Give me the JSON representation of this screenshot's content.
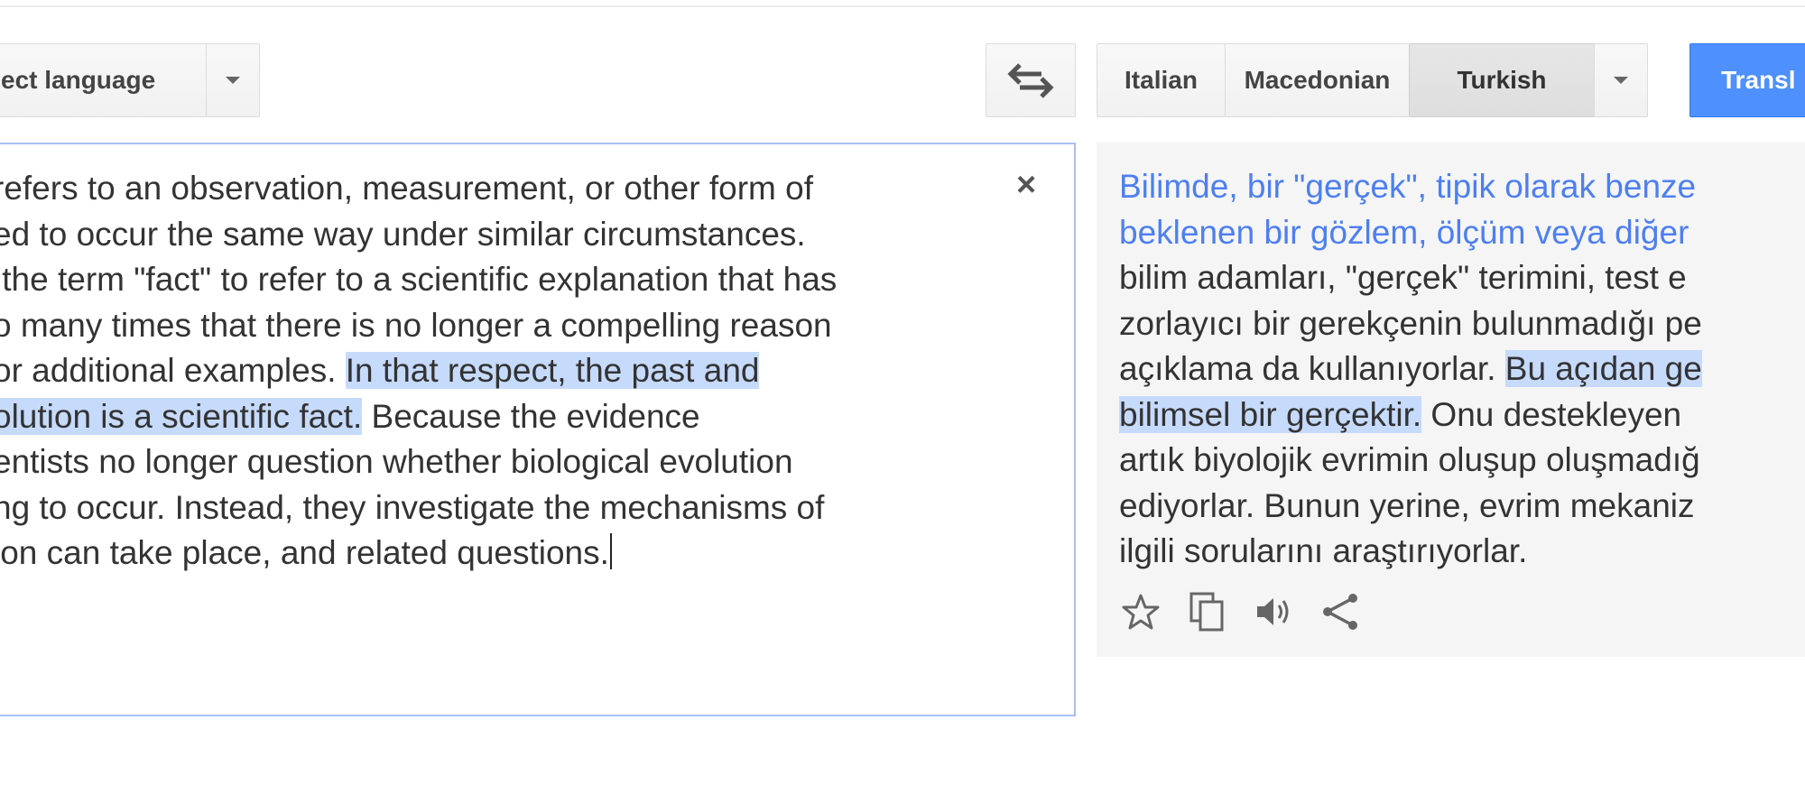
{
  "controls": {
    "detect_language": "ect language",
    "languages": [
      "Italian",
      "Macedonian",
      "Turkish"
    ],
    "selected_language": "Turkish",
    "translate_label": "Transl"
  },
  "source": {
    "lines": [
      "refers to an observation, measurement, or other form of",
      "ed to occur the same way under similar circumstances.",
      " the term \"fact\" to refer to a scientific explanation that has",
      "o many times that there is no longer a compelling reason",
      "or additional examples. ",
      "In that respect, the past and",
      "olution is a scientific fact.",
      " Because the evidence",
      "entists no longer question whether biological evolution",
      "ng to occur. Instead, they investigate the mechanisms of",
      "ion can take place, and related questions."
    ],
    "clear_glyph": "×"
  },
  "target": {
    "lines": [
      "Bilimde, bir \"gerçek\", tipik olarak benze",
      "beklenen bir gözlem, ölçüm veya diğer",
      "bilim adamları, \"gerçek\" terimini, test e",
      "zorlayıcı bir gerekçenin bulunmadığı pe",
      "açıklama da kullanıyorlar. ",
      "Bu açıdan ge",
      "bilimsel bir gerçektir.",
      " Onu destekleyen",
      "artık biyolojik evrimin oluşup oluşmadığ",
      "ediyorlar. Bunun yerine, evrim mekaniz",
      "ilgili sorularını araştırıyorlar."
    ]
  },
  "icons": [
    "swap-languages-icon",
    "star-icon",
    "copy-icon",
    "listen-icon",
    "share-icon"
  ],
  "colors": {
    "accent_blue": "#4d90fe",
    "highlight": "#c6dafc",
    "translated_blue_text": "#4d7ff0"
  }
}
